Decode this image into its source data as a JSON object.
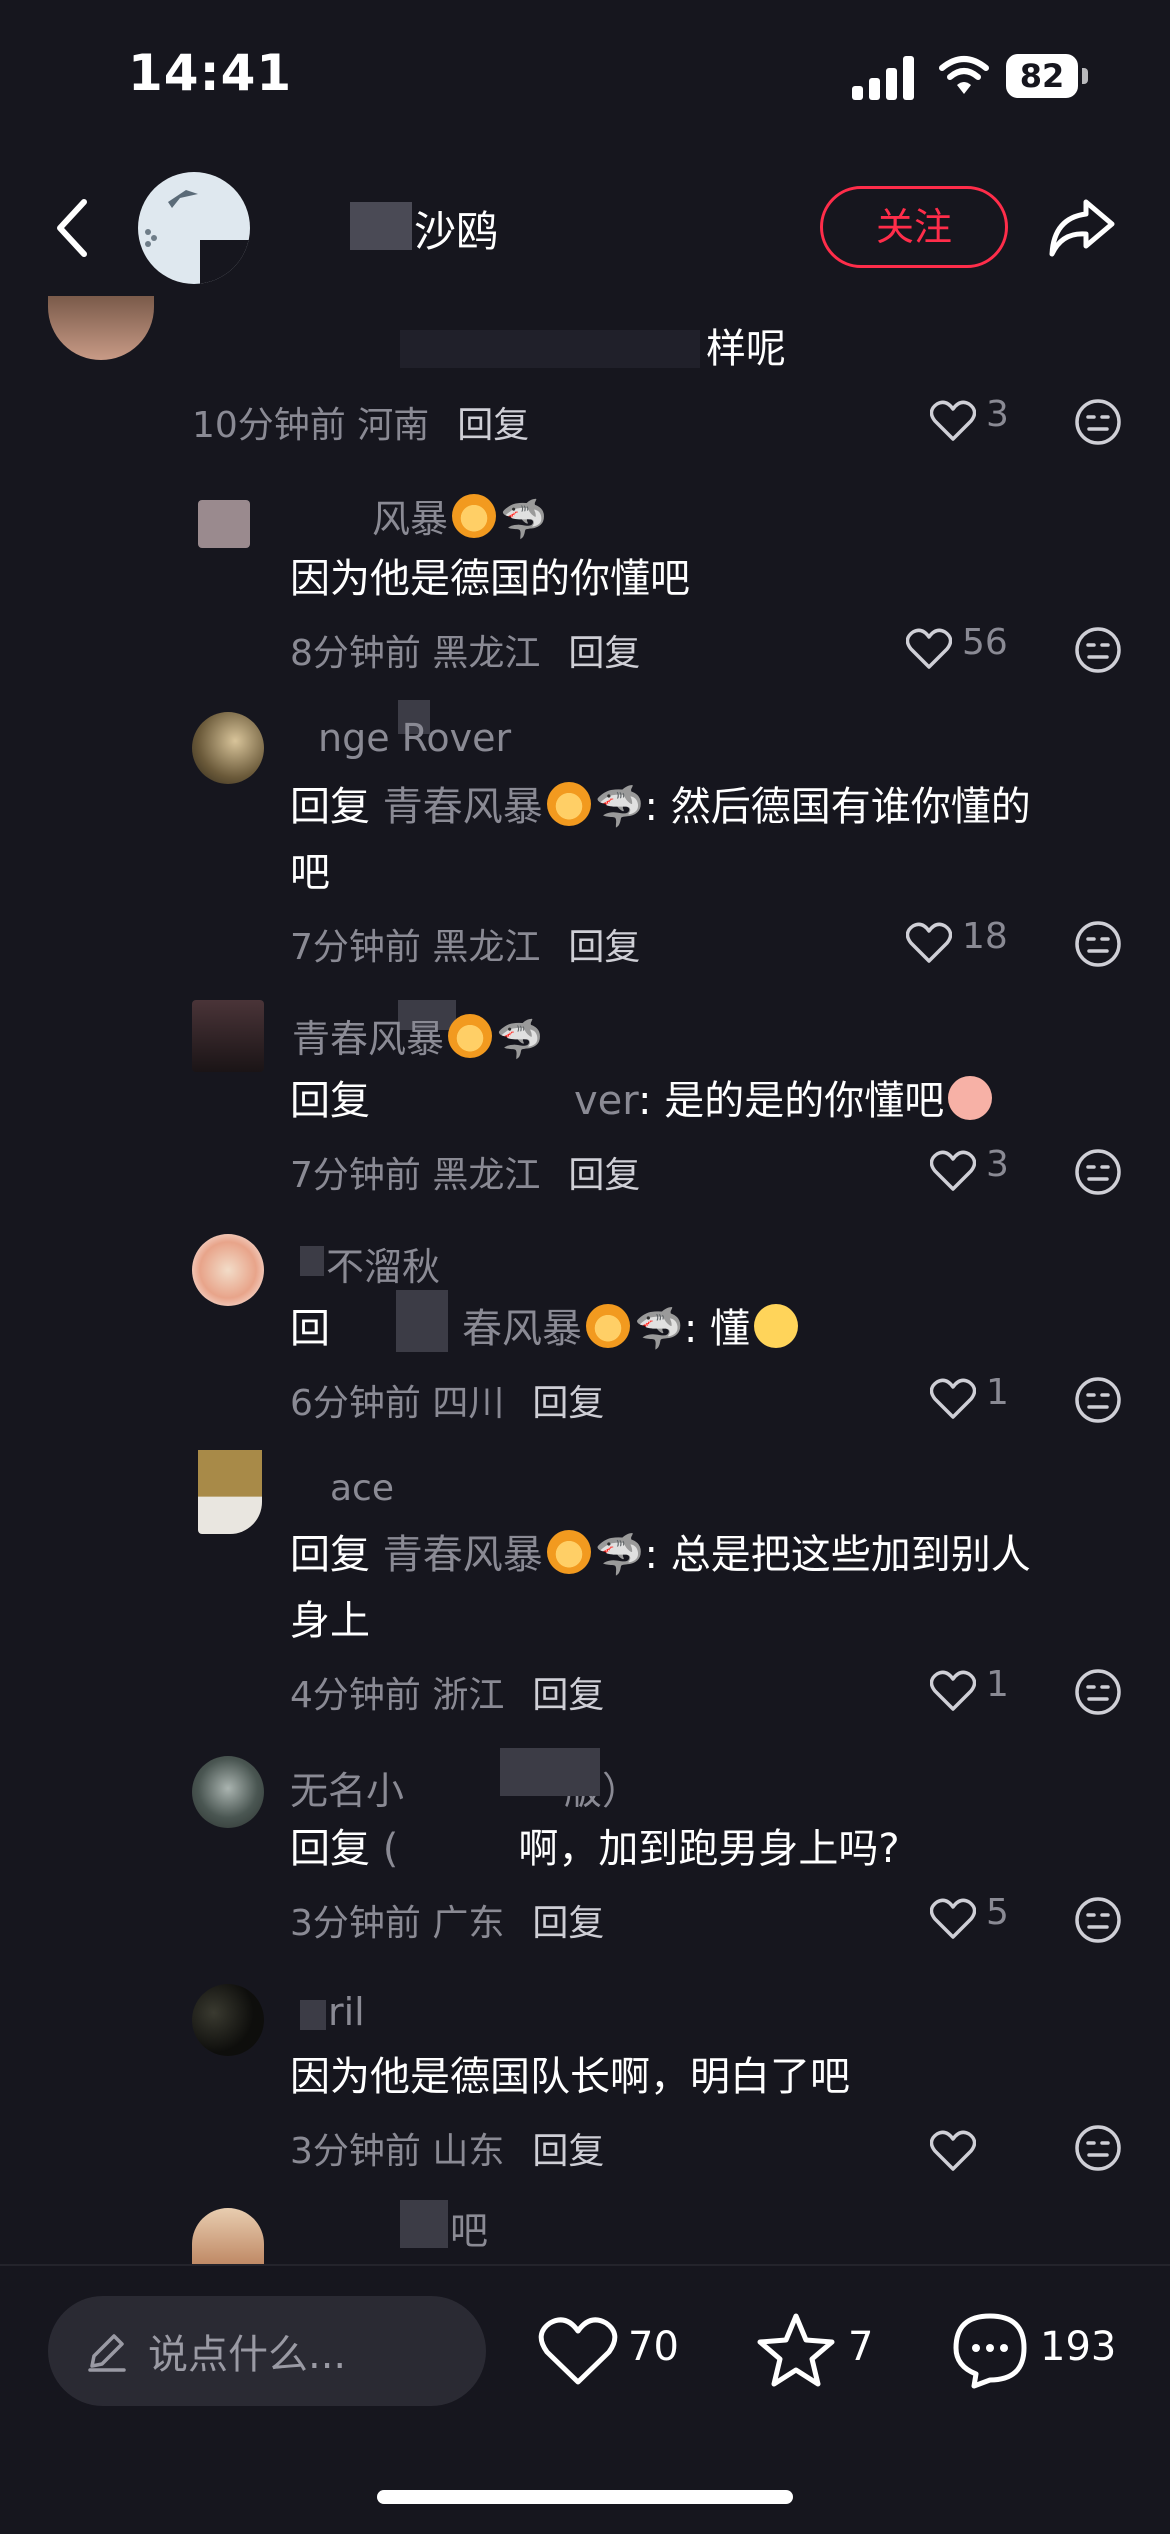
{
  "status": {
    "time": "14:41",
    "battery": "82"
  },
  "header": {
    "title": "沙鸥",
    "follow_label": "关注"
  },
  "comments": [
    {
      "name": "",
      "text": "样呢",
      "time": "10分钟前",
      "region": "河南",
      "reply": "回复",
      "likes": "3"
    },
    {
      "name": "风暴",
      "text": "因为他是德国的你懂吧",
      "time": "8分钟前",
      "region": "黑龙江",
      "reply": "回复",
      "likes": "56"
    },
    {
      "name": "nge Rover",
      "reply_prefix": "回复",
      "mention": "青春风暴",
      "text": ": 然后德国有谁你懂的",
      "text2": "吧",
      "time": "7分钟前",
      "region": "黑龙江",
      "reply": "回复",
      "likes": "18"
    },
    {
      "name": "青春风暴",
      "reply_prefix": "回复",
      "mention": "ver",
      "text": ": 是的是的你懂吧",
      "time": "7分钟前",
      "region": "黑龙江",
      "reply": "回复",
      "likes": "3"
    },
    {
      "name": "不溜秋",
      "reply_prefix": "回",
      "mention": "春风暴",
      "text": ": 懂",
      "time": "6分钟前",
      "region": "四川",
      "reply": "回复",
      "likes": "1"
    },
    {
      "name": "ace",
      "reply_prefix": "回复",
      "mention": "青春风暴",
      "text": ": 总是把这些加到别人",
      "text2": "身上",
      "time": "4分钟前",
      "region": "浙江",
      "reply": "回复",
      "likes": "1"
    },
    {
      "name": "无名小",
      "name_tail": "版）",
      "reply_prefix": "回复",
      "mention": "(",
      "text": "啊，加到跑男身上吗?",
      "time": "3分钟前",
      "region": "广东",
      "reply": "回复",
      "likes": "5"
    },
    {
      "name": "ril",
      "text": "因为他是德国队长啊，明白了吧",
      "time": "3分钟前",
      "region": "山东",
      "reply": "回复",
      "likes": ""
    },
    {
      "name": "吧"
    }
  ],
  "bottom": {
    "input_placeholder": "说点什么...",
    "likes": "70",
    "stars": "7",
    "comments": "193"
  },
  "colors": {
    "bg": "#16161e",
    "accent": "#ff2d4a",
    "muted": "#8a8a94"
  },
  "icons": [
    "back-icon",
    "share-icon",
    "heart-icon",
    "face-icon",
    "pencil-icon",
    "star-icon",
    "comment-icon"
  ]
}
